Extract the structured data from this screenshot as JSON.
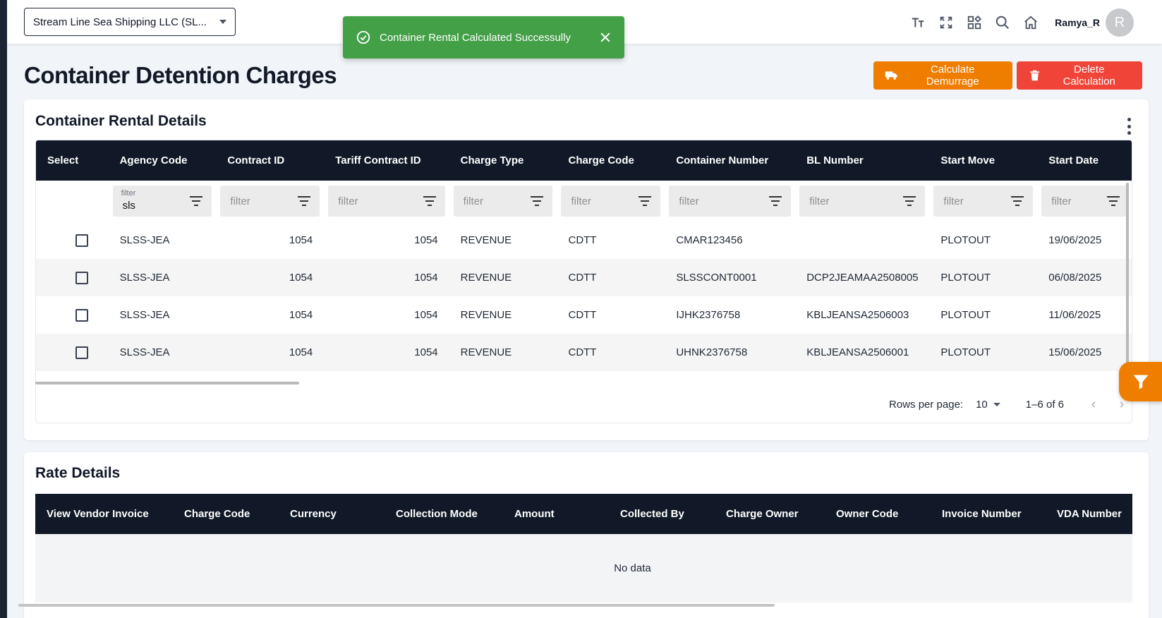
{
  "topbar": {
    "company": "Stream Line Sea Shipping LLC  (SL...",
    "icons": [
      "text-size-icon",
      "fullscreen-icon",
      "apps-icon",
      "search-icon",
      "home-icon"
    ],
    "user_name": "Ramya_R",
    "avatar_initial": "R"
  },
  "toast": {
    "message": "Container Rental Calculated Successully",
    "color": "#43a047"
  },
  "page": {
    "title": "Container Detention Charges",
    "calc_button": "Calculate Demurrage",
    "delete_button": "Delete Calculation"
  },
  "colors": {
    "accent": "#ef7d00",
    "danger": "#f04438",
    "header_bg": "#111827"
  },
  "rental": {
    "title": "Container Rental Details",
    "columns": [
      "Select",
      "Agency Code",
      "Contract ID",
      "Tariff Contract ID",
      "Charge Type",
      "Charge Code",
      "Container Number",
      "BL Number",
      "Start Move",
      "Start Date"
    ],
    "filter_label": "filter",
    "filter_placeholder": "filter",
    "agency_filter_value": "sls",
    "rows": [
      {
        "agency": "SLSS-JEA",
        "contract": "1054",
        "tariff": "1054",
        "charge_type": "REVENUE",
        "charge_code": "CDTT",
        "container": "CMAR123456",
        "bl": "",
        "start_move": "PLOTOUT",
        "start_date": "19/06/2025"
      },
      {
        "agency": "SLSS-JEA",
        "contract": "1054",
        "tariff": "1054",
        "charge_type": "REVENUE",
        "charge_code": "CDTT",
        "container": "SLSSCONT0001",
        "bl": "DCP2JEAMAA2508005",
        "start_move": "PLOTOUT",
        "start_date": "06/08/2025"
      },
      {
        "agency": "SLSS-JEA",
        "contract": "1054",
        "tariff": "1054",
        "charge_type": "REVENUE",
        "charge_code": "CDTT",
        "container": "IJHK2376758",
        "bl": "KBLJEANSA2506003",
        "start_move": "PLOTOUT",
        "start_date": "11/06/2025"
      },
      {
        "agency": "SLSS-JEA",
        "contract": "1054",
        "tariff": "1054",
        "charge_type": "REVENUE",
        "charge_code": "CDTT",
        "container": "UHNK2376758",
        "bl": "KBLJEANSA2506001",
        "start_move": "PLOTOUT",
        "start_date": "15/06/2025"
      }
    ],
    "pager": {
      "rows_per_page_label": "Rows per page:",
      "rows_per_page": "10",
      "range": "1–6 of 6"
    }
  },
  "rate": {
    "title": "Rate Details",
    "columns": [
      "View Vendor Invoice",
      "Charge Code",
      "Currency",
      "Collection Mode",
      "Amount",
      "Collected By",
      "Charge Owner",
      "Owner Code",
      "Invoice Number",
      "VDA Number"
    ],
    "empty_text": "No data"
  }
}
